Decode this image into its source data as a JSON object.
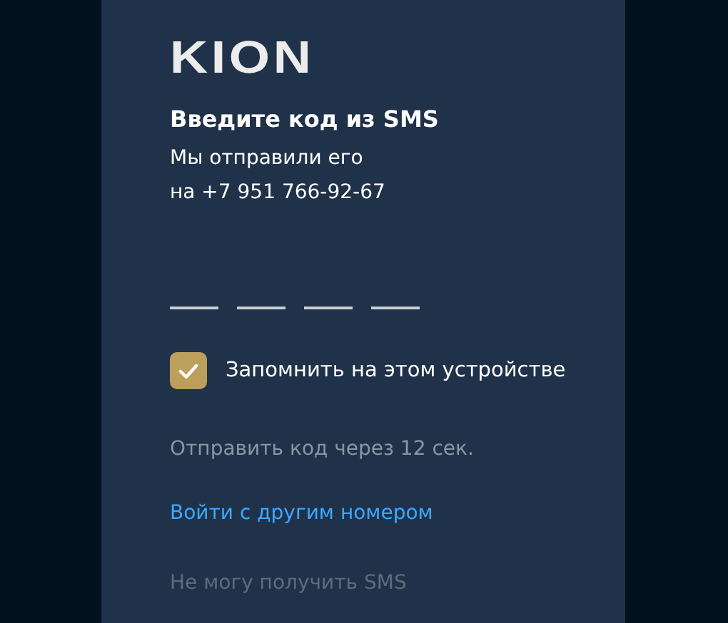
{
  "logo": {
    "text": "KION"
  },
  "title": "Введите код из SMS",
  "subtitle_lines": [
    "Мы отправили его",
    "на +7 951 766-92-67"
  ],
  "code_fields": [
    {
      "focused": false
    },
    {
      "focused": false
    },
    {
      "focused": false
    },
    {
      "focused": false
    }
  ],
  "remember": {
    "label": "Запомнить на этом устройстве",
    "checked": true
  },
  "resend": {
    "text": "Отправить код через 12 сек.",
    "disabled": true
  },
  "other_number_link": {
    "text": "Войти с другим номером"
  },
  "cant_receive": {
    "text": "Не могу получить SMS",
    "disabled": true
  }
}
